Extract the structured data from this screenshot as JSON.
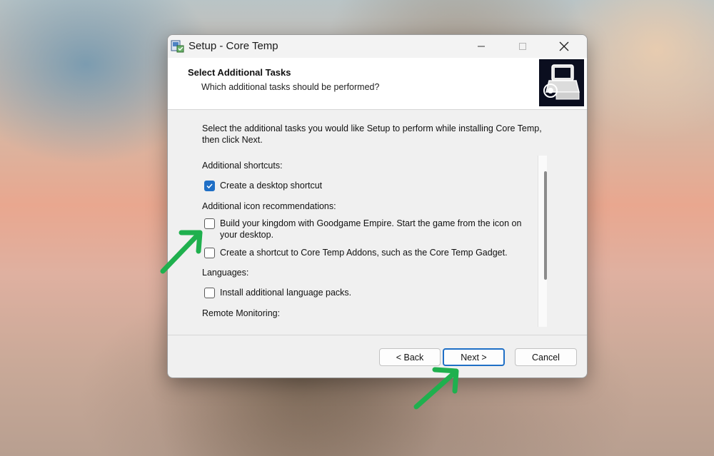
{
  "window": {
    "title": "Setup - Core Temp"
  },
  "header": {
    "title": "Select Additional Tasks",
    "subtitle": "Which additional tasks should be performed?"
  },
  "content": {
    "intro": "Select the additional tasks you would like Setup to perform while installing Core Temp, then click Next.",
    "groups": [
      {
        "label": "Additional shortcuts:",
        "tasks": [
          {
            "label": "Create a desktop shortcut",
            "checked": true
          }
        ]
      },
      {
        "label": "Additional icon recommendations:",
        "tasks": [
          {
            "label": "Build your kingdom with Goodgame Empire. Start the game from the icon on your desktop.",
            "checked": false
          },
          {
            "label": "Create a shortcut to Core Temp Addons, such as the Core Temp Gadget.",
            "checked": false
          }
        ]
      },
      {
        "label": "Languages:",
        "tasks": [
          {
            "label": "Install additional language packs.",
            "checked": false
          }
        ]
      },
      {
        "label": "Remote Monitoring:",
        "tasks": []
      }
    ]
  },
  "footer": {
    "back_label": "< Back",
    "next_label": "Next >",
    "cancel_label": "Cancel"
  },
  "colors": {
    "accent": "#1f6fc6",
    "annotation_arrow": "#1fb04e"
  },
  "icons": {
    "app": "installer-icon",
    "minimize": "minimize-icon",
    "maximize": "maximize-icon",
    "close": "close-icon",
    "checkmark": "checkmark-icon",
    "arrow": "arrow-annotation-icon"
  }
}
